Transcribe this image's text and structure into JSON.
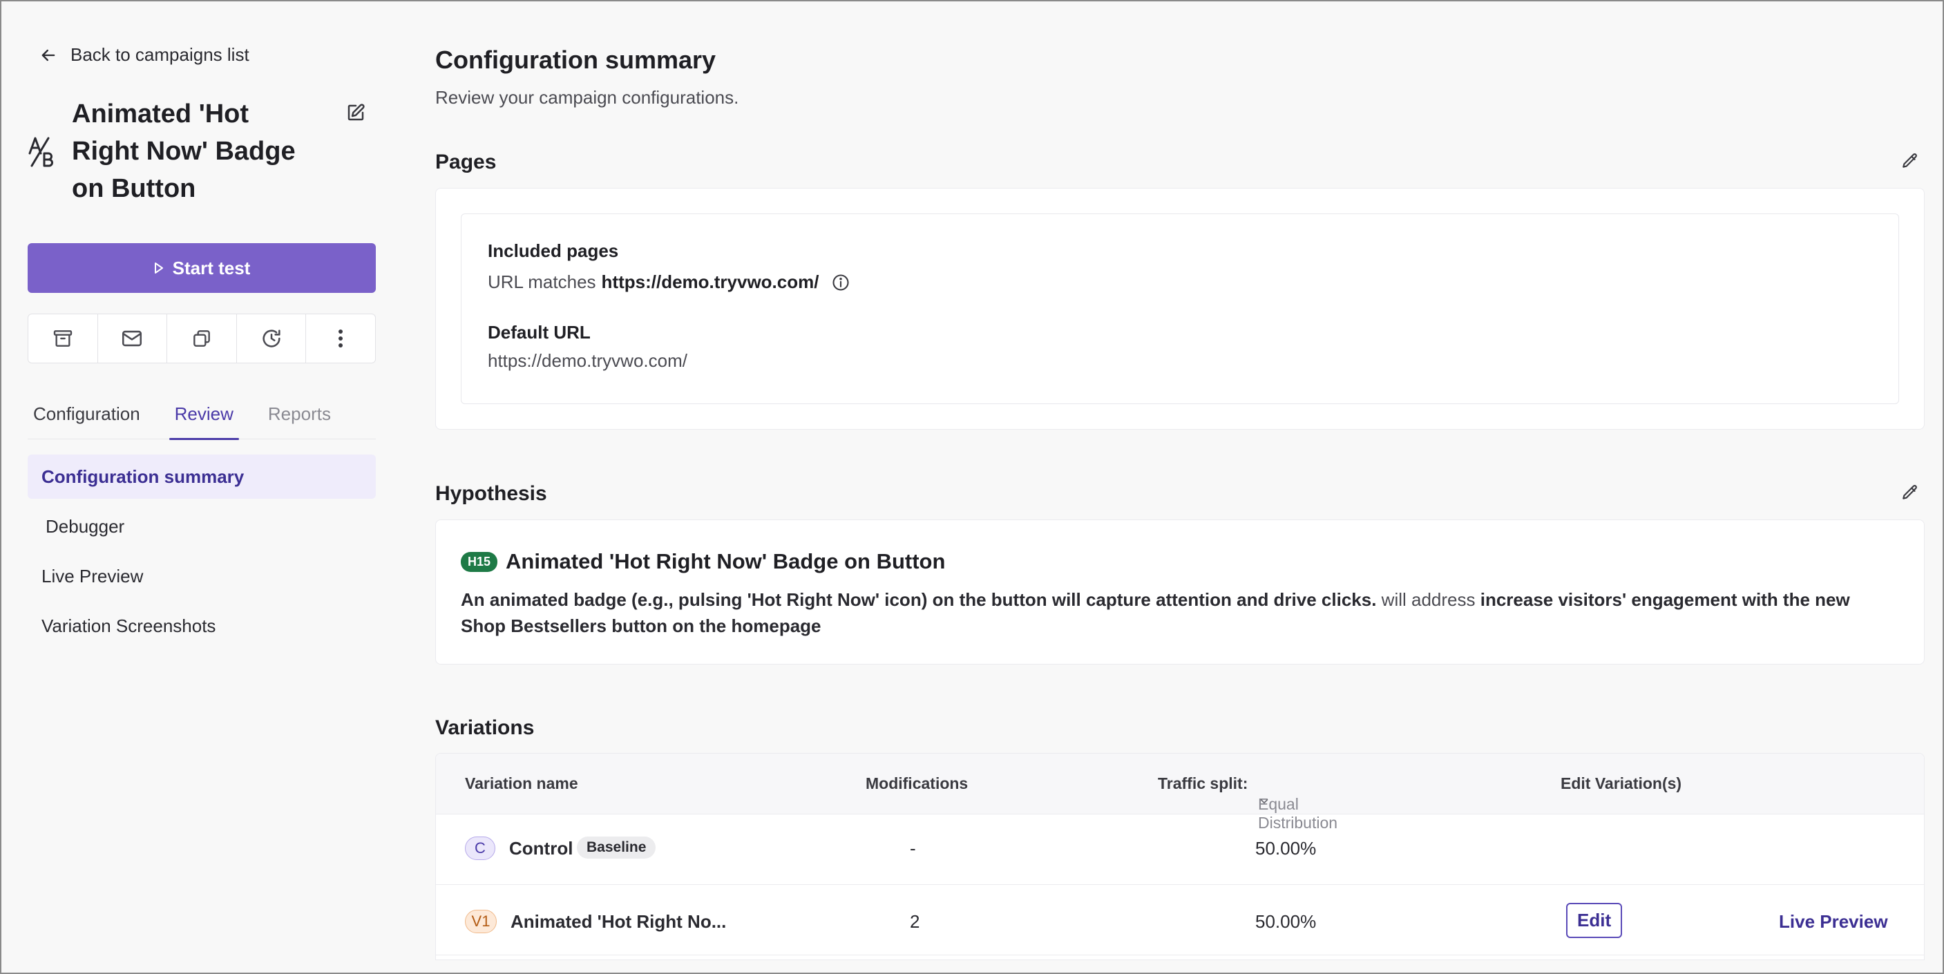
{
  "sidebar": {
    "back_label": "Back to campaigns list",
    "campaign_title": "Animated 'Hot Right Now' Badge on Button",
    "start_label": "Start test",
    "tabs": [
      "Configuration",
      "Review",
      "Reports"
    ],
    "nav": [
      "Configuration summary",
      "Debugger",
      "Live Preview",
      "Variation Screenshots"
    ]
  },
  "main": {
    "title": "Configuration summary",
    "subtitle": "Review your campaign configurations.",
    "pages": {
      "heading": "Pages",
      "included_label": "Included pages",
      "url_prefix": "URL matches",
      "url_value": "https://demo.tryvwo.com/",
      "default_label": "Default URL",
      "default_value": "https://demo.tryvwo.com/"
    },
    "hypothesis": {
      "heading": "Hypothesis",
      "badge": "H15",
      "title": "Animated 'Hot Right Now' Badge on Button",
      "part1": "An animated badge (e.g., pulsing 'Hot Right Now' icon) on the button will capture attention and drive clicks.",
      "connector": " will address ",
      "part2": "increase visitors' engagement with the new Shop Bestsellers button on the homepage"
    },
    "variations": {
      "heading": "Variations",
      "columns": {
        "name": "Variation name",
        "modifications": "Modifications",
        "traffic_label": "Traffic split:",
        "traffic_value": "Equal Distribution",
        "edit": "Edit Variation(s)"
      },
      "rows": [
        {
          "code": "C",
          "name": "Control",
          "badge": "Baseline",
          "modifications": "-",
          "traffic": "50.00%"
        },
        {
          "code": "V1",
          "name": "Animated 'Hot Right No...",
          "modifications": "2",
          "traffic": "50.00%",
          "edit_label": "Edit",
          "preview_label": "Live Preview"
        }
      ]
    }
  },
  "colors": {
    "accent": "#7a61c9",
    "accent_dark": "#3c2f93",
    "hyp_badge": "#1e7a46"
  }
}
